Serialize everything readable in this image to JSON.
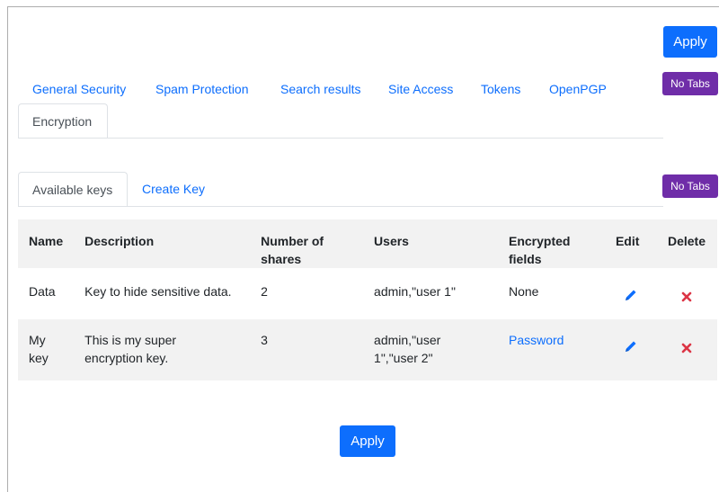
{
  "buttons": {
    "apply_top": "Apply",
    "apply_bottom": "Apply",
    "no_tabs_1": "No Tabs",
    "no_tabs_2": "No Tabs"
  },
  "main_tabs": {
    "items": [
      "General Security",
      "Spam Protection",
      "Search results",
      "Site Access",
      "Tokens",
      "OpenPGP"
    ],
    "active": "Encryption"
  },
  "sub_tabs": {
    "active": "Available keys",
    "other": "Create Key"
  },
  "table": {
    "headers": {
      "name": "Name",
      "description": "Description",
      "shares_l1": "Number of",
      "shares_l2": "shares",
      "users": "Users",
      "fields_l1": "Encrypted",
      "fields_l2": "fields",
      "edit": "Edit",
      "delete": "Delete"
    },
    "rows": [
      {
        "name_l1": "Data",
        "name_l2": "",
        "desc_l1": "Key to hide sensitive data.",
        "desc_l2": "",
        "shares": "2",
        "users_l1": "admin,\"user 1\"",
        "users_l2": "",
        "fields": "None",
        "fields_is_link": false
      },
      {
        "name_l1": "My",
        "name_l2": "key",
        "desc_l1": "This is my super",
        "desc_l2": "encryption key.",
        "shares": "3",
        "users_l1": "admin,\"user",
        "users_l2": "1\",\"user 2\"",
        "fields": "Password",
        "fields_is_link": true
      }
    ]
  },
  "icons": {
    "edit": "pencil-icon",
    "delete": "close-icon"
  },
  "colors": {
    "primary": "#0d6efd",
    "purple": "#6f2da8",
    "delete_red": "#dc3545",
    "header_bg": "#f2f2f2"
  }
}
